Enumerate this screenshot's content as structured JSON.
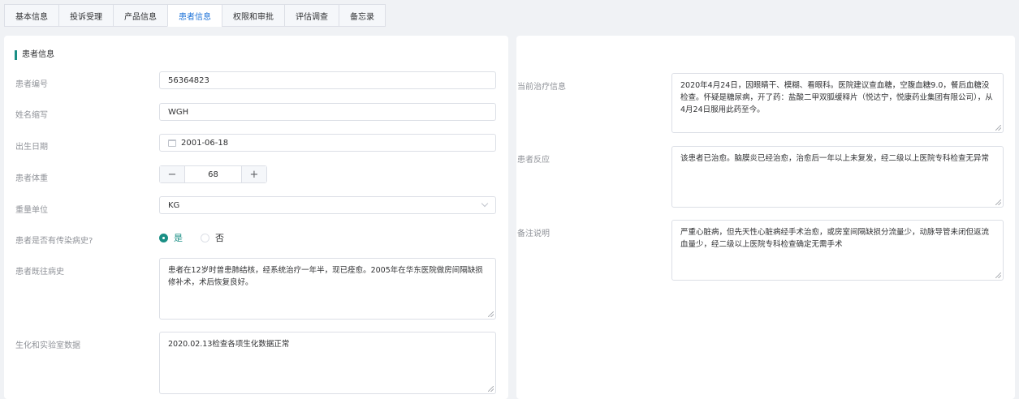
{
  "tabs": [
    "基本信息",
    "投诉受理",
    "产品信息",
    "患者信息",
    "权限和审批",
    "评估调查",
    "备忘录"
  ],
  "section_title": "患者信息",
  "left": {
    "patient_id_label": "患者编号",
    "patient_id_value": "56364823",
    "name_label": "姓名缩写",
    "name_value": "WGH",
    "dob_label": "出生日期",
    "dob_value": "2001-06-18",
    "weight_label": "患者体重",
    "weight_value": "68",
    "weight_unit_label": "重量单位",
    "weight_unit_value": "KG",
    "infectious_label": "患者是否有传染病史?",
    "radio_yes": "是",
    "radio_no": "否",
    "history_label": "患者既往病史",
    "history_value": "患者在12岁时曾患肺结核，经系统治疗一年半，现已痊愈。2005年在华东医院做房间隔缺损修补术，术后恢复良好。",
    "lab_label": "生化和实验室数据",
    "lab_value": "2020.02.13检查各项生化数据正常"
  },
  "right": {
    "treatment_label": "当前治疗信息",
    "treatment_value": "2020年4月24日，因眼睛干、模糊、看眼科。医院建议查血糖，空腹血糖9.0，餐后血糖没检查。怀疑是糖尿病，开了药：盐酸二甲双胍缓释片（悦达宁，悦康药业集团有限公司），从4月24日服用此药至今。",
    "reaction_label": "患者反应",
    "reaction_value": "该患者已治愈。脑膜炎已经治愈，治愈后一年以上未复发，经二级以上医院专科检查无异常",
    "notes_label": "备注说明",
    "notes_value": "严重心脏病，但先天性心脏病经手术治愈，或房室间隔缺损分流量少，动脉导管未闭但返流血量少，经二级以上医院专科检查确定无需手术"
  },
  "stepper": {
    "minus": "−",
    "plus": "+"
  }
}
